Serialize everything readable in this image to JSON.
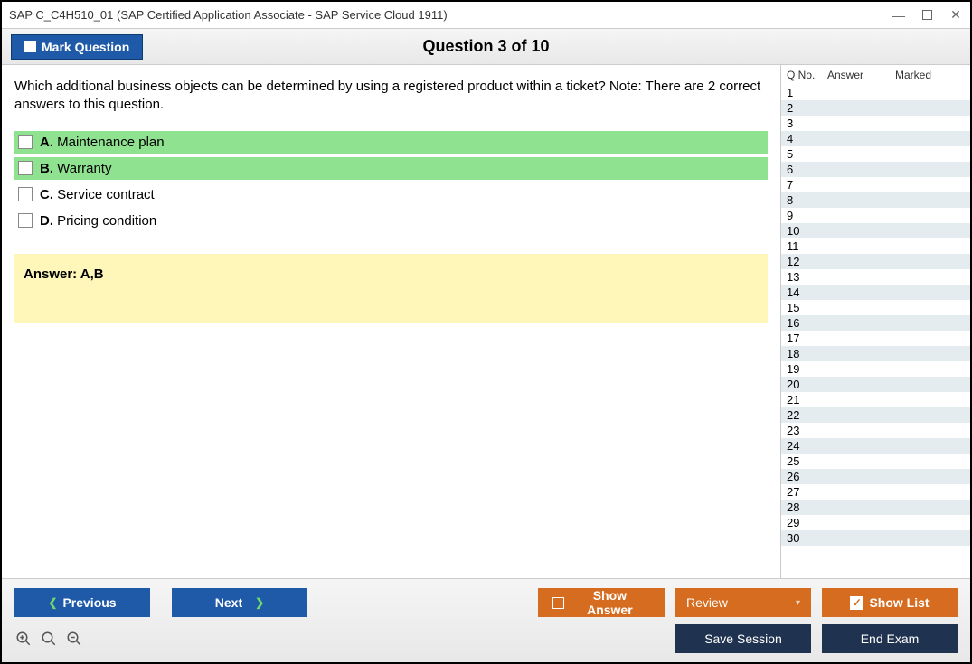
{
  "window": {
    "title": "SAP C_C4H510_01 (SAP Certified Application Associate - SAP Service Cloud 1911)"
  },
  "toolbar": {
    "mark_label": "Mark Question",
    "question_label": "Question 3 of 10"
  },
  "question": {
    "text": "Which additional business objects can be determined by using a registered product within a ticket? Note: There are 2 correct answers to this question.",
    "options": [
      {
        "letter": "A.",
        "text": "Maintenance plan",
        "correct": true
      },
      {
        "letter": "B.",
        "text": "Warranty",
        "correct": true
      },
      {
        "letter": "C.",
        "text": "Service contract",
        "correct": false
      },
      {
        "letter": "D.",
        "text": "Pricing condition",
        "correct": false
      }
    ],
    "answer_label": "Answer: A,B"
  },
  "sidebar": {
    "headers": {
      "q": "Q No.",
      "a": "Answer",
      "m": "Marked"
    },
    "rows": [
      1,
      2,
      3,
      4,
      5,
      6,
      7,
      8,
      9,
      10,
      11,
      12,
      13,
      14,
      15,
      16,
      17,
      18,
      19,
      20,
      21,
      22,
      23,
      24,
      25,
      26,
      27,
      28,
      29,
      30
    ]
  },
  "footer": {
    "previous": "Previous",
    "next": "Next",
    "show_answer": "Show Answer",
    "review": "Review",
    "show_list": "Show List",
    "save_session": "Save Session",
    "end_exam": "End Exam"
  }
}
